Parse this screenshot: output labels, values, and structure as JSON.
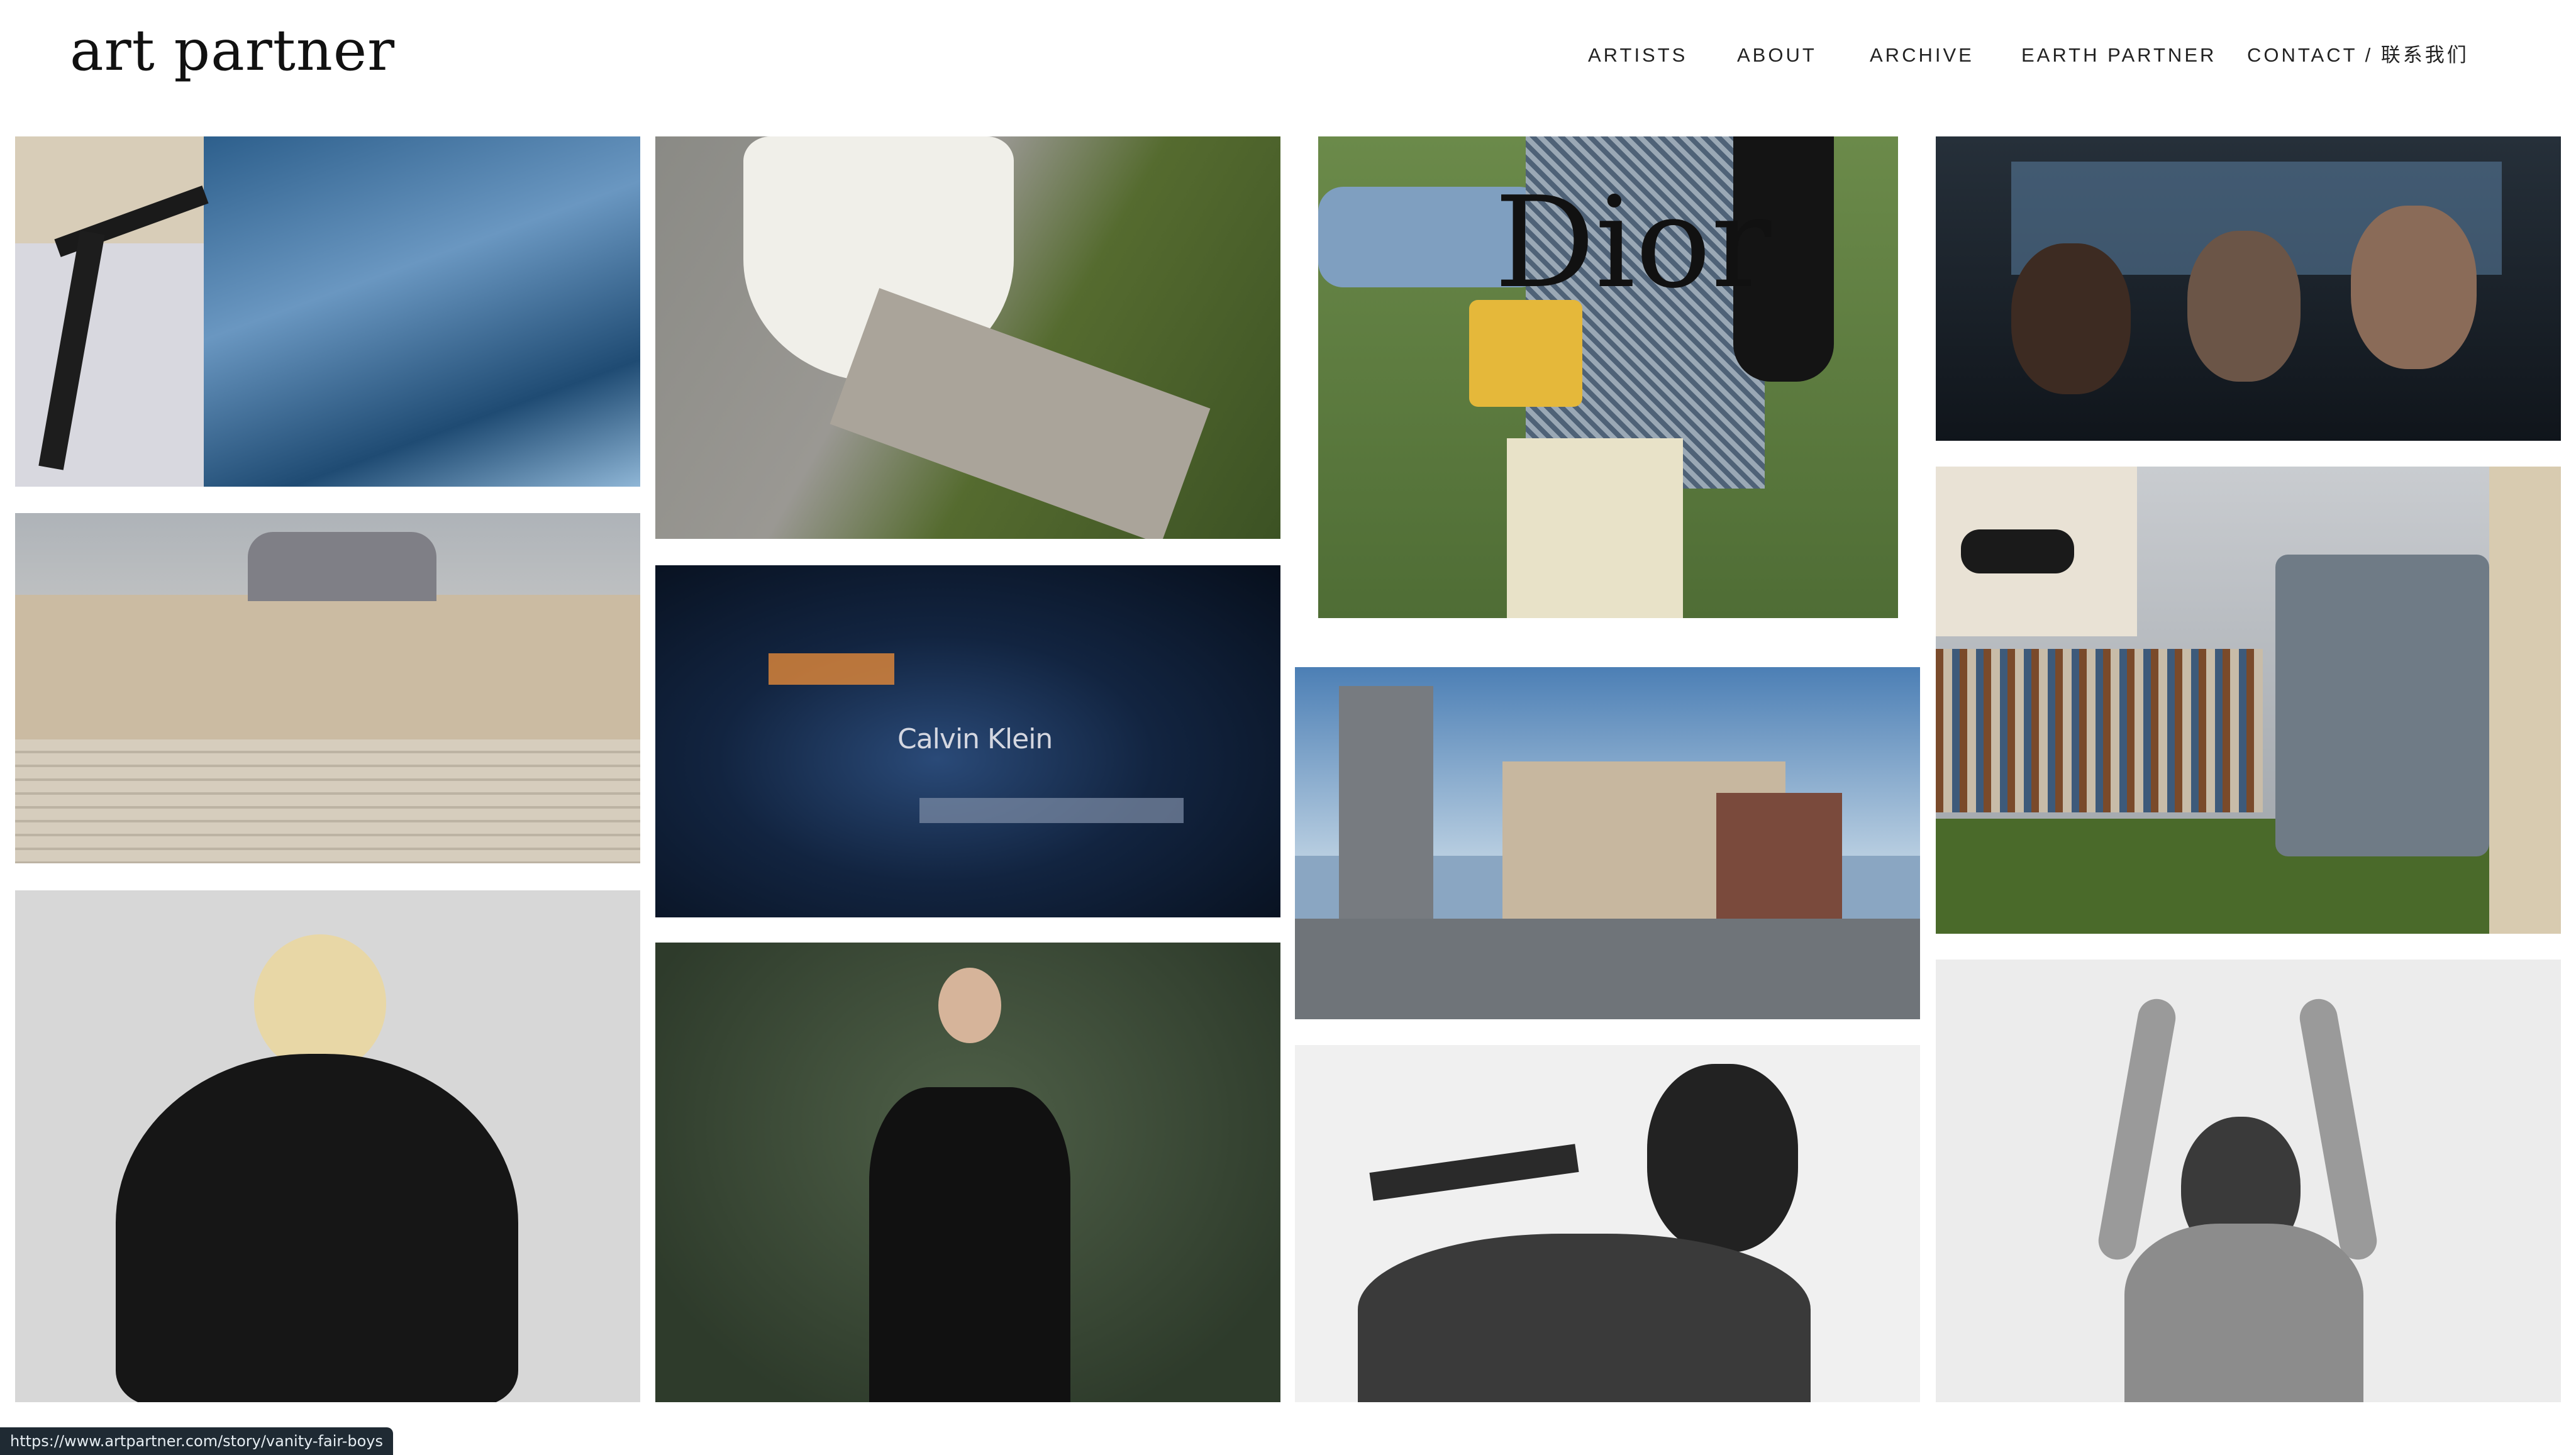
{
  "header": {
    "logo": "art partner",
    "nav": [
      {
        "label": "ARTISTS"
      },
      {
        "label": "ABOUT"
      },
      {
        "label": "ARCHIVE"
      },
      {
        "label": "EARTH PARTNER"
      },
      {
        "label": "CONTACT / 联系我们"
      }
    ]
  },
  "tiles": [
    {
      "brand": ""
    },
    {
      "brand": ""
    },
    {
      "brand": ""
    },
    {
      "brand": ""
    },
    {
      "brand": ""
    },
    {
      "brand": "Calvin Klein"
    },
    {
      "brand": ""
    },
    {
      "brand": "Dior"
    },
    {
      "brand": ""
    },
    {
      "brand": ""
    },
    {
      "brand": ""
    },
    {
      "brand": ""
    },
    {
      "brand": ""
    }
  ],
  "status_bar": {
    "url": "https://www.artpartner.com/story/vanity-fair-boys"
  },
  "colors": {
    "background": "#ffffff",
    "text": "#222222",
    "status_bar": "#1f2a33"
  }
}
